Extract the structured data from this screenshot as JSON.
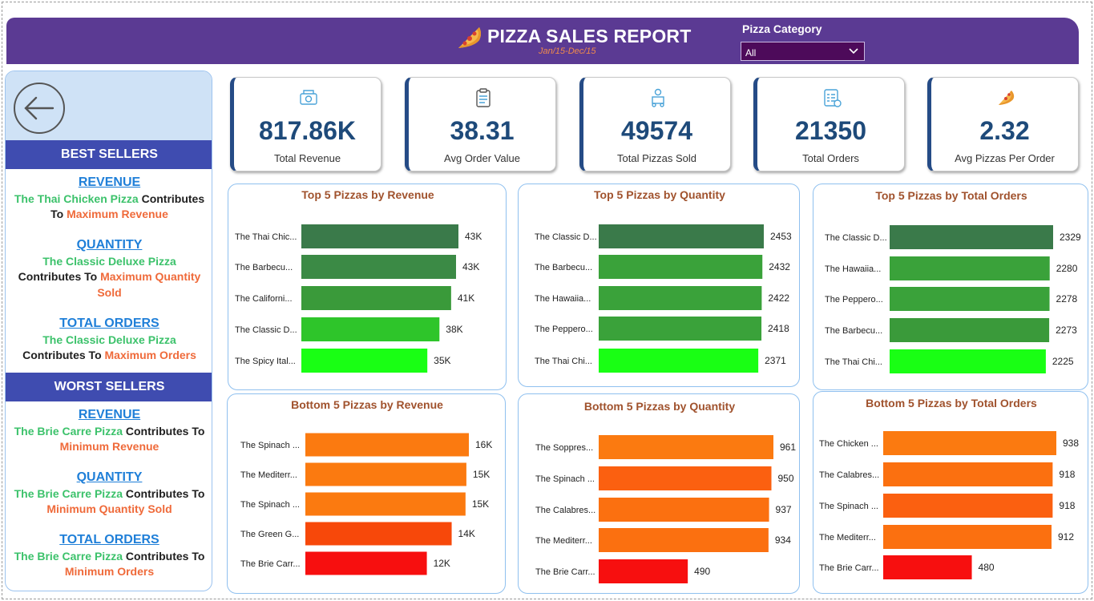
{
  "header": {
    "title": "PIZZA SALES REPORT",
    "date_range": "Jan/15-Dec/15",
    "filter_label": "Pizza Category",
    "filter_value": "All",
    "bg_color": "#5b3a93"
  },
  "left_panel": {
    "best_sellers_title": "BEST SELLERS",
    "worst_sellers_title": "WORST SELLERS",
    "best": {
      "revenue_heading": "REVENUE",
      "revenue_pizza": "The Thai Chicken Pizza",
      "revenue_mid": " Contributes",
      "revenue_to": "To ",
      "revenue_tail": "Maximum Revenue",
      "quantity_heading": "QUANTITY",
      "quantity_pizza": "The Classic Deluxe Pizza",
      "quantity_mid": "Contributes To ",
      "quantity_tail1": "Maximum Quantity",
      "quantity_tail2": "Sold",
      "orders_heading": "TOTAL ORDERS",
      "orders_pizza": "The Classic Deluxe Pizza",
      "orders_mid": "Contributes To ",
      "orders_tail": "Maximum Orders"
    },
    "worst": {
      "revenue_heading": "REVENUE",
      "revenue_pizza": "The Brie Carre Pizza",
      "revenue_mid": " Contributes To",
      "revenue_tail": "Minimum Revenue",
      "quantity_heading": "QUANTITY",
      "quantity_pizza": "The Brie Carre Pizza",
      "quantity_mid": " Contributes To",
      "quantity_tail": "Minimum  Quantity Sold",
      "orders_heading": "TOTAL ORDERS",
      "orders_pizza": "The Brie Carre Pizza",
      "orders_mid": " Contributes To",
      "orders_tail": "Minimum Orders"
    }
  },
  "kpis": [
    {
      "value": "817.86K",
      "label": "Total Revenue",
      "icon": "money-icon"
    },
    {
      "value": "38.31",
      "label": "Avg Order Value",
      "icon": "clipboard-icon"
    },
    {
      "value": "49574",
      "label": "Total Pizzas Sold",
      "icon": "delivery-icon"
    },
    {
      "value": "21350",
      "label": "Total Orders",
      "icon": "order-list-icon"
    },
    {
      "value": "2.32",
      "label": "Avg Pizzas Per Order",
      "icon": "pizza-slice-icon"
    }
  ],
  "chart_data": [
    {
      "type": "bar",
      "orientation": "horizontal",
      "title": "Top 5 Pizzas by Revenue",
      "categories": [
        "The Thai Chic...",
        "The Barbecu...",
        "The Californi...",
        "The Classic D...",
        "The Spicy Ital..."
      ],
      "values": [
        43434,
        42768,
        41410,
        38180,
        34832
      ],
      "value_labels": [
        "43K",
        "43K",
        "41K",
        "38K",
        "35K"
      ],
      "colors": [
        "#3a7a4a",
        "#3b8a45",
        "#3a9a3a",
        "#2ec52a",
        "#19ff14"
      ]
    },
    {
      "type": "bar",
      "orientation": "horizontal",
      "title": "Top 5 Pizzas by Quantity",
      "categories": [
        "The Classic D...",
        "The Barbecu...",
        "The Hawaiia...",
        "The Peppero...",
        "The Thai Chi..."
      ],
      "values": [
        2453,
        2432,
        2422,
        2418,
        2371
      ],
      "value_labels": [
        "2453",
        "2432",
        "2422",
        "2418",
        "2371"
      ],
      "colors": [
        "#3a7a4a",
        "#3aa23a",
        "#3aa23a",
        "#3aa23a",
        "#19ff14"
      ]
    },
    {
      "type": "bar",
      "orientation": "horizontal",
      "title": "Top 5 Pizzas by Total Orders",
      "categories": [
        "The Classic D...",
        "The Hawaiia...",
        "The Peppero...",
        "The Barbecu...",
        "The Thai Chi..."
      ],
      "values": [
        2329,
        2280,
        2278,
        2273,
        2225
      ],
      "value_labels": [
        "2329",
        "2280",
        "2278",
        "2273",
        "2225"
      ],
      "colors": [
        "#3a7a4a",
        "#3aa23a",
        "#3aa23a",
        "#3a9a3a",
        "#19ff14"
      ]
    },
    {
      "type": "bar",
      "orientation": "horizontal",
      "title": "Bottom 5 Pizzas by Revenue",
      "categories": [
        "The Spinach ...",
        "The Mediterr...",
        "The Spinach ...",
        "The Green G...",
        "The Brie Carr..."
      ],
      "values": [
        15596,
        15360,
        15278,
        13956,
        11588
      ],
      "value_labels": [
        "16K",
        "15K",
        "15K",
        "14K",
        "12K"
      ],
      "colors": [
        "#fb7a10",
        "#fb7a10",
        "#fb7a10",
        "#f7480a",
        "#f70f0f"
      ]
    },
    {
      "type": "bar",
      "orientation": "horizontal",
      "title": "Bottom 5 Pizzas by Quantity",
      "categories": [
        "The Soppres...",
        "The Spinach ...",
        "The Calabres...",
        "The Mediterr...",
        "The Brie Carr..."
      ],
      "values": [
        961,
        950,
        937,
        934,
        490
      ],
      "value_labels": [
        "961",
        "950",
        "937",
        "934",
        "490"
      ],
      "colors": [
        "#fb7a10",
        "#fb6010",
        "#fb7010",
        "#fb7010",
        "#f70f0f"
      ]
    },
    {
      "type": "bar",
      "orientation": "horizontal",
      "title": "Bottom 5 Pizzas by Total Orders",
      "categories": [
        "The Chicken ...",
        "The Calabres...",
        "The Spinach ...",
        "The Mediterr...",
        "The Brie Carr..."
      ],
      "values": [
        938,
        918,
        918,
        912,
        480
      ],
      "value_labels": [
        "938",
        "918",
        "918",
        "912",
        "480"
      ],
      "colors": [
        "#fb7a10",
        "#fb7010",
        "#fb6010",
        "#fb7010",
        "#f70f0f"
      ]
    }
  ]
}
